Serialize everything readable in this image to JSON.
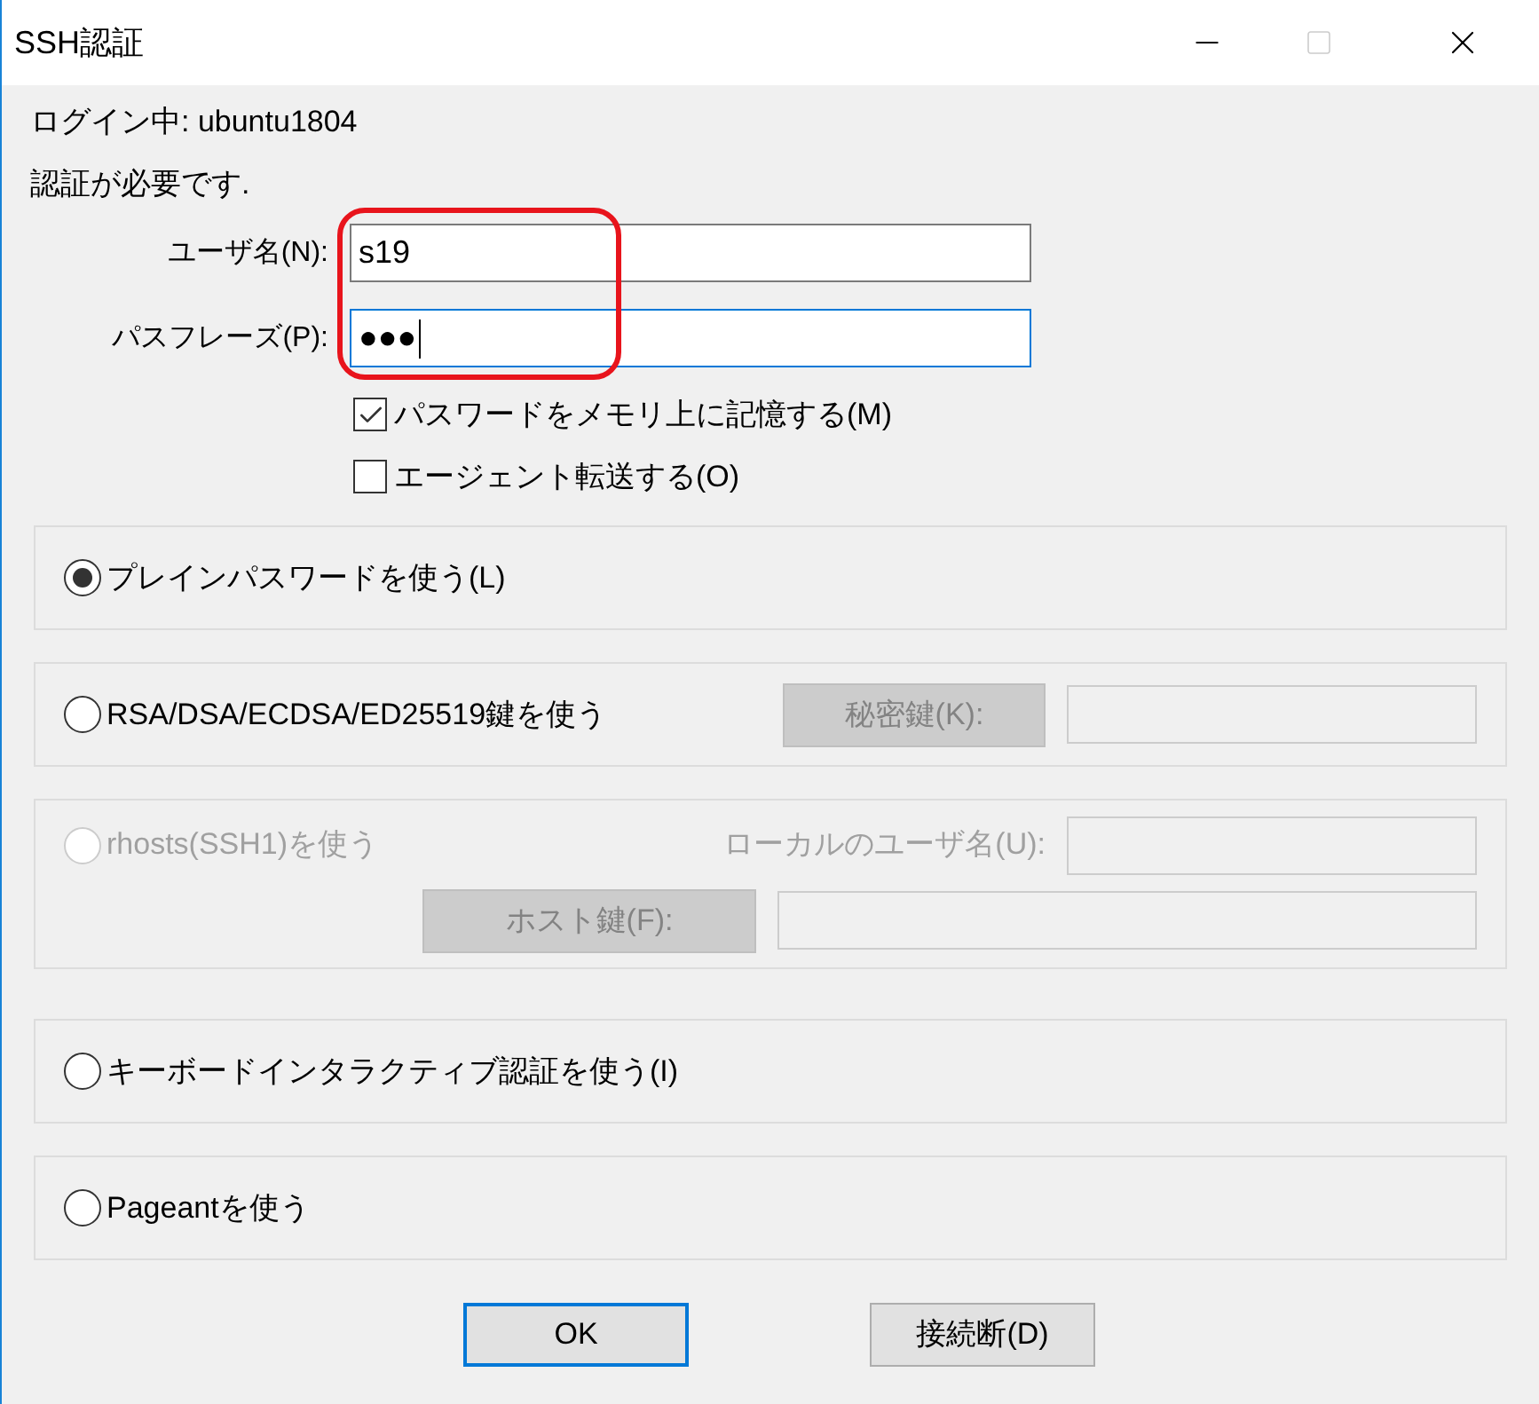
{
  "window": {
    "title": "SSH認証",
    "maximize_disabled": true
  },
  "login_info": "ログイン中: ubuntu1804",
  "message": "認証が必要です.",
  "fields": [
    {
      "label": "ユーザ名(N):",
      "value": "s19",
      "focused": false
    },
    {
      "label": "パスフレーズ(P):",
      "value": "●●●",
      "focused": true
    }
  ],
  "options": [
    {
      "label": "パスワードをメモリ上に記憶する(M)",
      "checked": true
    },
    {
      "label": "エージェント転送する(O)",
      "checked": false
    }
  ],
  "methods": [
    {
      "label": "プレインパスワードを使う(L)",
      "selected": true,
      "disabled": false
    },
    {
      "label": "RSA/DSA/ECDSA/ED25519鍵を使う",
      "selected": false,
      "disabled": false,
      "rows": [
        [
          {
            "kind": "button",
            "label": "秘密鍵(K):",
            "disabled": true
          },
          {
            "kind": "field",
            "disabled": true
          }
        ]
      ]
    },
    {
      "label": "rhosts(SSH1)を使う",
      "selected": false,
      "disabled": true,
      "rows": [
        [
          {
            "kind": "label",
            "label": "ローカルのユーザ名(U):",
            "disabled": true
          },
          {
            "kind": "field",
            "disabled": true
          }
        ],
        [
          {
            "kind": "button",
            "label": "ホスト鍵(F):",
            "disabled": true
          },
          {
            "kind": "field",
            "disabled": true
          }
        ]
      ]
    },
    {
      "label": "キーボードインタラクティブ認証を使う(I)",
      "selected": false,
      "disabled": false
    },
    {
      "label": "Pageantを使う",
      "selected": false,
      "disabled": false
    }
  ],
  "buttons": [
    {
      "label": "OK",
      "default": true
    },
    {
      "label": "接続断(D)",
      "default": false
    }
  ]
}
